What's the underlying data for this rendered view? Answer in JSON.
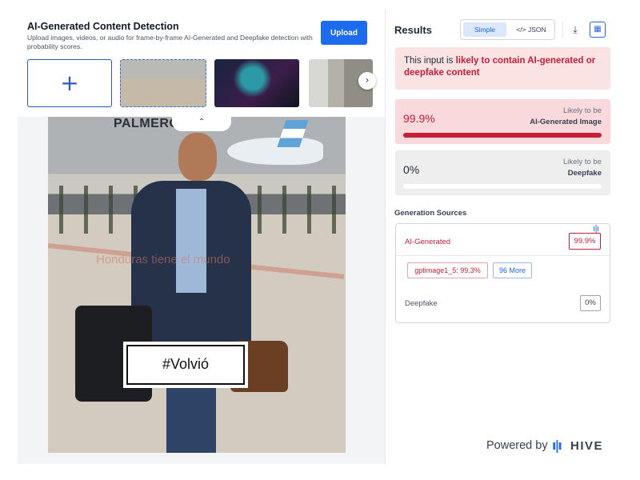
{
  "header": {
    "title": "AI-Generated Content Detection",
    "description": "Upload images, videos, or audio for frame-by-frame AI-Generated and Deepfake detection with probability scores.",
    "upload_label": "Upload"
  },
  "thumbnails": {
    "add_icon": "+",
    "items": [
      {
        "icon": "photo-man-with-luggage",
        "selected": true
      },
      {
        "icon": "photo-woman-neon-city",
        "selected": false
      },
      {
        "icon": "photo-interior-room",
        "selected": false
      }
    ],
    "next_icon": "›"
  },
  "preview": {
    "collapse_icon": "⌃",
    "sign_text": "PALMEROLA",
    "overlay_text": "Honduras tiene el mundo",
    "caption": "#Volvió"
  },
  "results": {
    "title": "Results",
    "view_toggle": {
      "simple_label": "Simple",
      "json_label": "</> JSON",
      "selected": "Simple"
    },
    "download_icon": "⤓",
    "grid_icon": "▦",
    "verdict": {
      "prefix": "This input is ",
      "highlight": "likely to contain AI-generated or deepfake content"
    },
    "scores": [
      {
        "value_text": "99.9%",
        "value": 0.999,
        "label_top": "Likely to be",
        "label_bottom": "AI-Generated Image",
        "color": "#c81e3a"
      },
      {
        "value_text": "0%",
        "value": 0.0,
        "label_top": "Likely to be",
        "label_bottom": "Deepfake",
        "color": "#9ca3af"
      }
    ],
    "generation_sources": {
      "title": "Generation Sources",
      "ai_label": "AI-Generated",
      "ai_value": "99.9%",
      "models": [
        {
          "label": "gptimage1_5: 99.3%"
        }
      ],
      "more_label": "96 More",
      "deepfake_label": "Deepfake",
      "deepfake_value": "0%"
    }
  },
  "footer": {
    "powered_by": "Powered by",
    "brand": "HIVE",
    "brand_icon": "ı|ı"
  },
  "colors": {
    "accent": "#1d6cf0",
    "alert": "#c81e3a",
    "alert_bg": "#fbe3e4"
  }
}
